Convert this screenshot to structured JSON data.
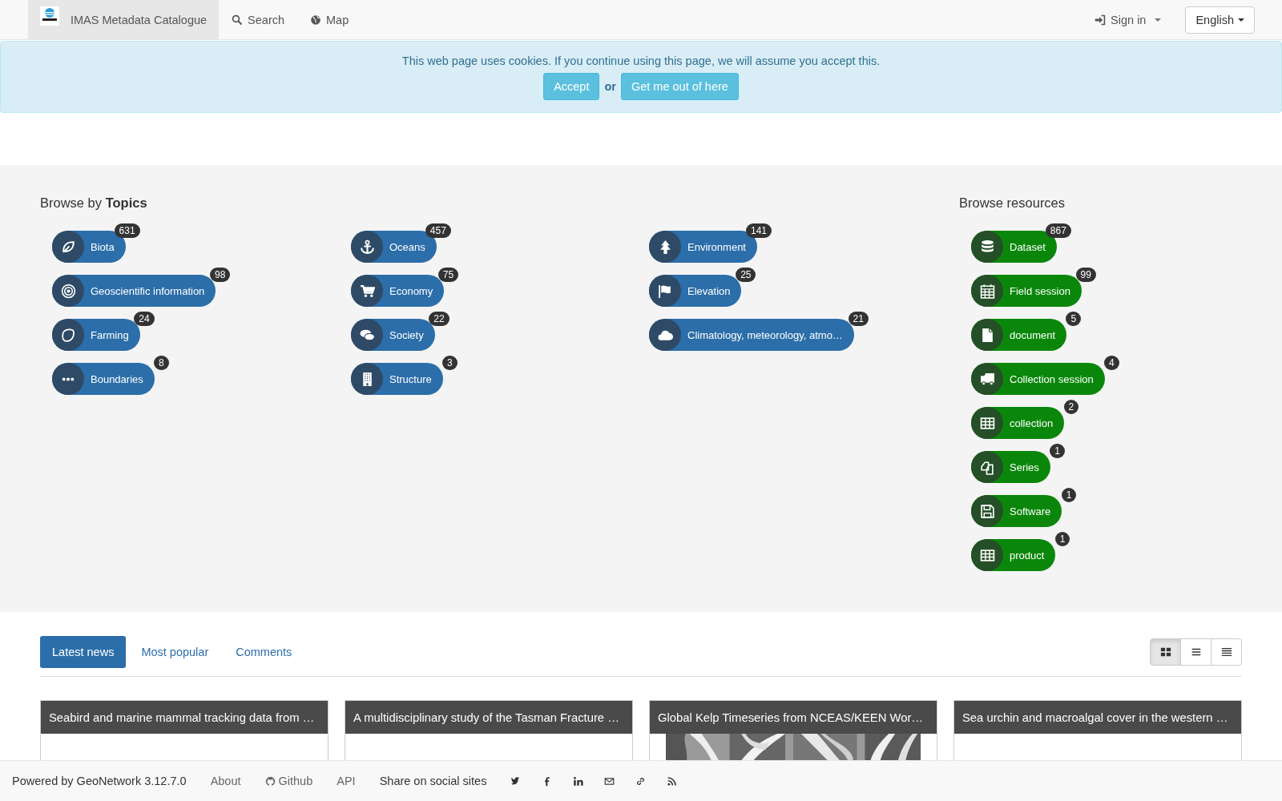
{
  "navbar": {
    "brand": "IMAS Metadata Catalogue",
    "brand_selected": true,
    "links": [
      "Search",
      "Map"
    ],
    "sign_in": "Sign in",
    "language": "English"
  },
  "cookie_banner": {
    "message": "This web page uses cookies. If you continue using this page, we will assume you accept this.",
    "accept": "Accept",
    "or": "or",
    "decline": "Get me out of here"
  },
  "topics": {
    "title": "Browse by **Topics**",
    "items": [
      {
        "label": "Biota",
        "count": "631"
      },
      {
        "label": "Oceans",
        "count": "457"
      },
      {
        "label": "Environment",
        "count": "141"
      },
      {
        "label": "Geoscientific information",
        "count": "98"
      },
      {
        "label": "Economy",
        "count": "75"
      },
      {
        "label": "Elevation",
        "count": "25"
      },
      {
        "label": "Farming",
        "count": "24"
      },
      {
        "label": "Society",
        "count": "22"
      },
      {
        "label": "Climatology, meteorology, atmo…",
        "count": "21"
      },
      {
        "label": "Boundaries",
        "count": "8"
      },
      {
        "label": "Structure",
        "count": "3"
      }
    ]
  },
  "resources": {
    "title": "Browse resources",
    "items": [
      {
        "label": "Dataset",
        "count": "867"
      },
      {
        "label": "Field session",
        "count": "99"
      },
      {
        "label": "document",
        "count": "5"
      },
      {
        "label": "Collection session",
        "count": "4"
      },
      {
        "label": "collection",
        "count": "2"
      },
      {
        "label": "Series",
        "count": "1"
      },
      {
        "label": "Software",
        "count": "1"
      },
      {
        "label": "product",
        "count": "1"
      }
    ]
  },
  "tabs": [
    {
      "label": "Latest news",
      "selected": true
    },
    {
      "label": "Most popular",
      "selected": false
    },
    {
      "label": "Comments",
      "selected": false
    }
  ],
  "view_toggles": [
    {
      "selected": true
    },
    {
      "selected": false
    },
    {
      "selected": false
    }
  ],
  "cards": [
    {
      "title": "Seabird and marine mammal tracking data from …"
    },
    {
      "title": "A multidisciplinary study of the Tasman Fracture …"
    },
    {
      "title": "Global Kelp Timeseries from NCEAS/KEEN Wor…",
      "kind": "picture"
    },
    {
      "title": "Sea urchin and macroalgal cover in the western …"
    }
  ],
  "footer": {
    "powered_by": "Powered by GeoNetwork 3.12.7.0",
    "links": [
      "About",
      "Github",
      "API"
    ],
    "share": "Share on social sites"
  }
}
